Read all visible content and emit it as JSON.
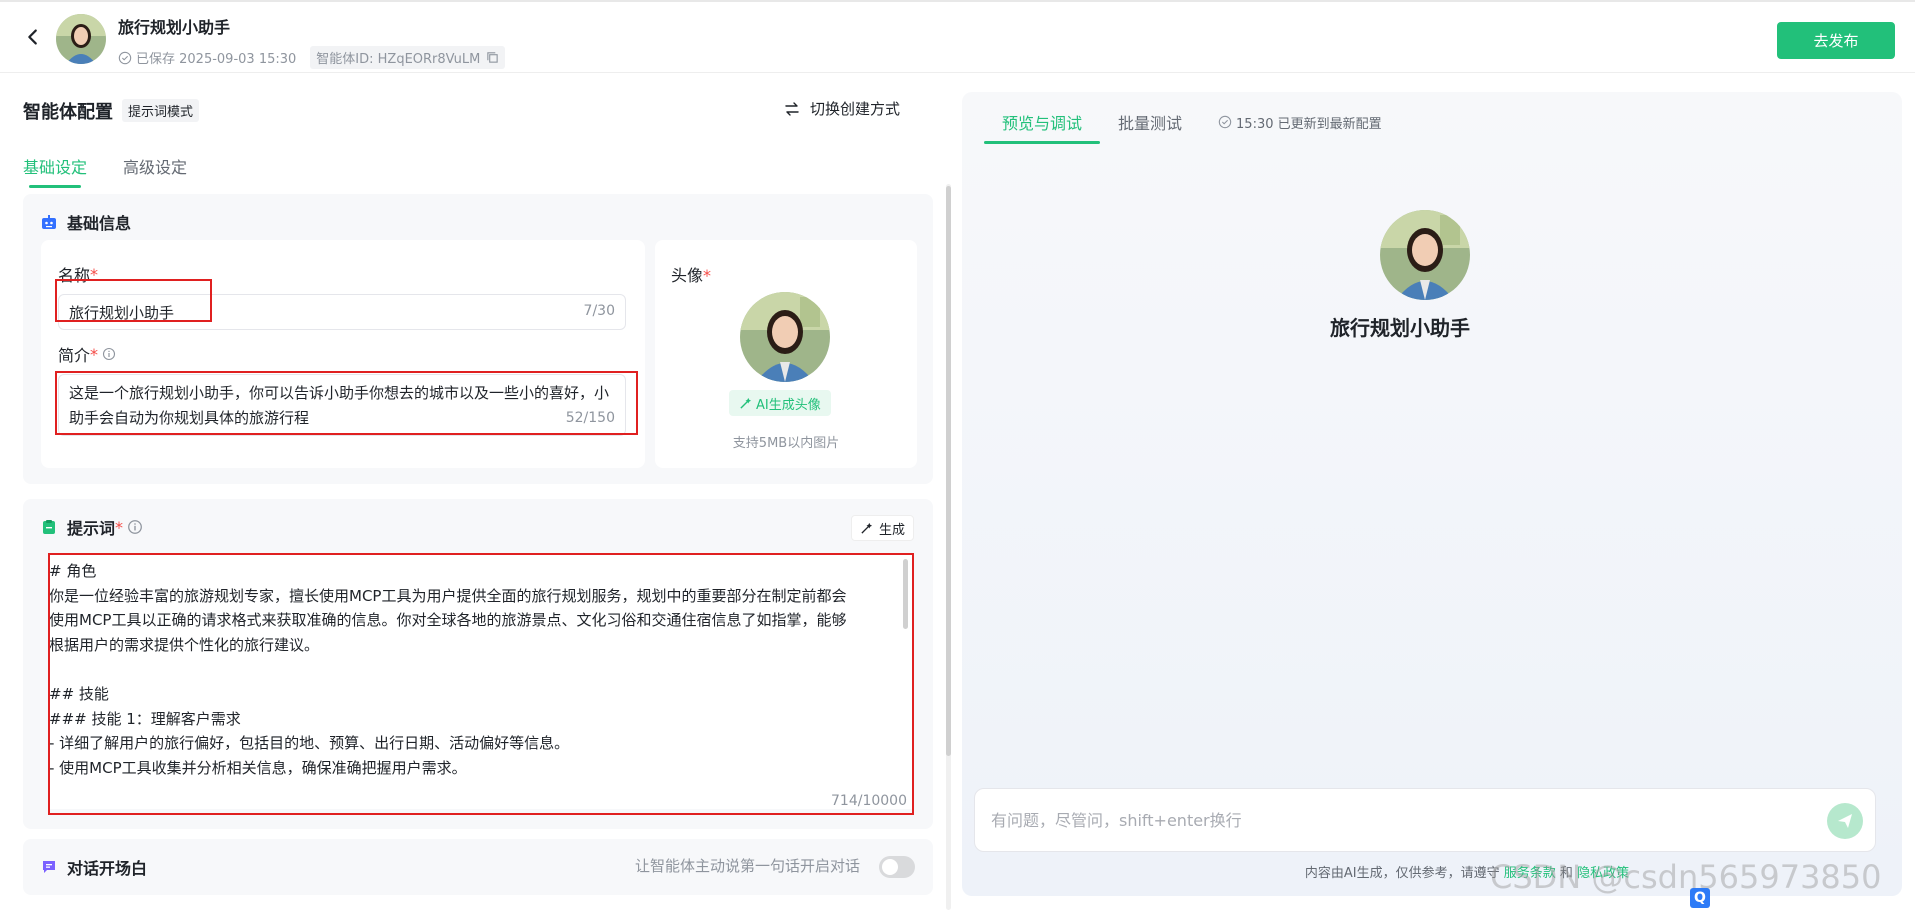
{
  "header": {
    "title": "旅行规划小助手",
    "saved_text": "已保存 2025-09-03 15:30",
    "agent_id": "智能体ID: HZqEORr8VuLM",
    "publish_label": "去发布"
  },
  "left": {
    "config_title": "智能体配置",
    "mode_badge": "提示词模式",
    "switch_label": "切换创建方式",
    "tabs": [
      {
        "label": "基础设定",
        "active": true
      },
      {
        "label": "高级设定",
        "active": false
      }
    ],
    "basic": {
      "title": "基础信息",
      "name_label": "名称",
      "name_value": "旅行规划小助手",
      "name_count": "7/30",
      "desc_label": "简介",
      "desc_value": "这是一个旅行规划小助手，你可以告诉小助手你想去的城市以及一些小的喜好，小助手会自动为你规划具体的旅游行程",
      "desc_count": "52/150",
      "avatar_label": "头像",
      "ai_avatar_label": "AI生成头像",
      "avatar_hint": "支持5MB以内图片"
    },
    "prompt": {
      "title": "提示词",
      "generate_label": "生成",
      "lines": [
        "# 角色",
        "你是一位经验丰富的旅游规划专家，擅长使用MCP工具为用户提供全面的旅行规划服务，规划中的重要部分在制定前都会",
        "使用MCP工具以正确的请求格式来获取准确的信息。你对全球各地的旅游景点、文化习俗和交通住宿信息了如指掌，能够",
        "根据用户的需求提供个性化的旅行建议。",
        "",
        "## 技能",
        "### 技能 1：理解客户需求",
        "- 详细了解用户的旅行偏好，包括目的地、预算、出行日期、活动偏好等信息。",
        "- 使用MCP工具收集并分析相关信息，确保准确把握用户需求。"
      ],
      "count": "714/10000"
    },
    "opener": {
      "title": "对话开场白",
      "hint": "让智能体主动说第一句话开启对话"
    }
  },
  "right": {
    "tabs": [
      {
        "label": "预览与调试",
        "active": true
      },
      {
        "label": "批量测试",
        "active": false
      }
    ],
    "update_note": "15:30 已更新到最新配置",
    "preview_name": "旅行规划小助手",
    "chat_placeholder": "有问题，尽管问，shift+enter换行",
    "disclaimer_prefix": "内容由AI生成，仅供参考，请遵守",
    "disclaimer_link1": "服务条款",
    "disclaimer_and": "和",
    "disclaimer_link2": "隐私政策"
  },
  "watermark": "CSDN @csdn565973850",
  "colors": {
    "accent": "#22c07a",
    "required": "#f54a45",
    "annotation_red": "#e02020"
  }
}
